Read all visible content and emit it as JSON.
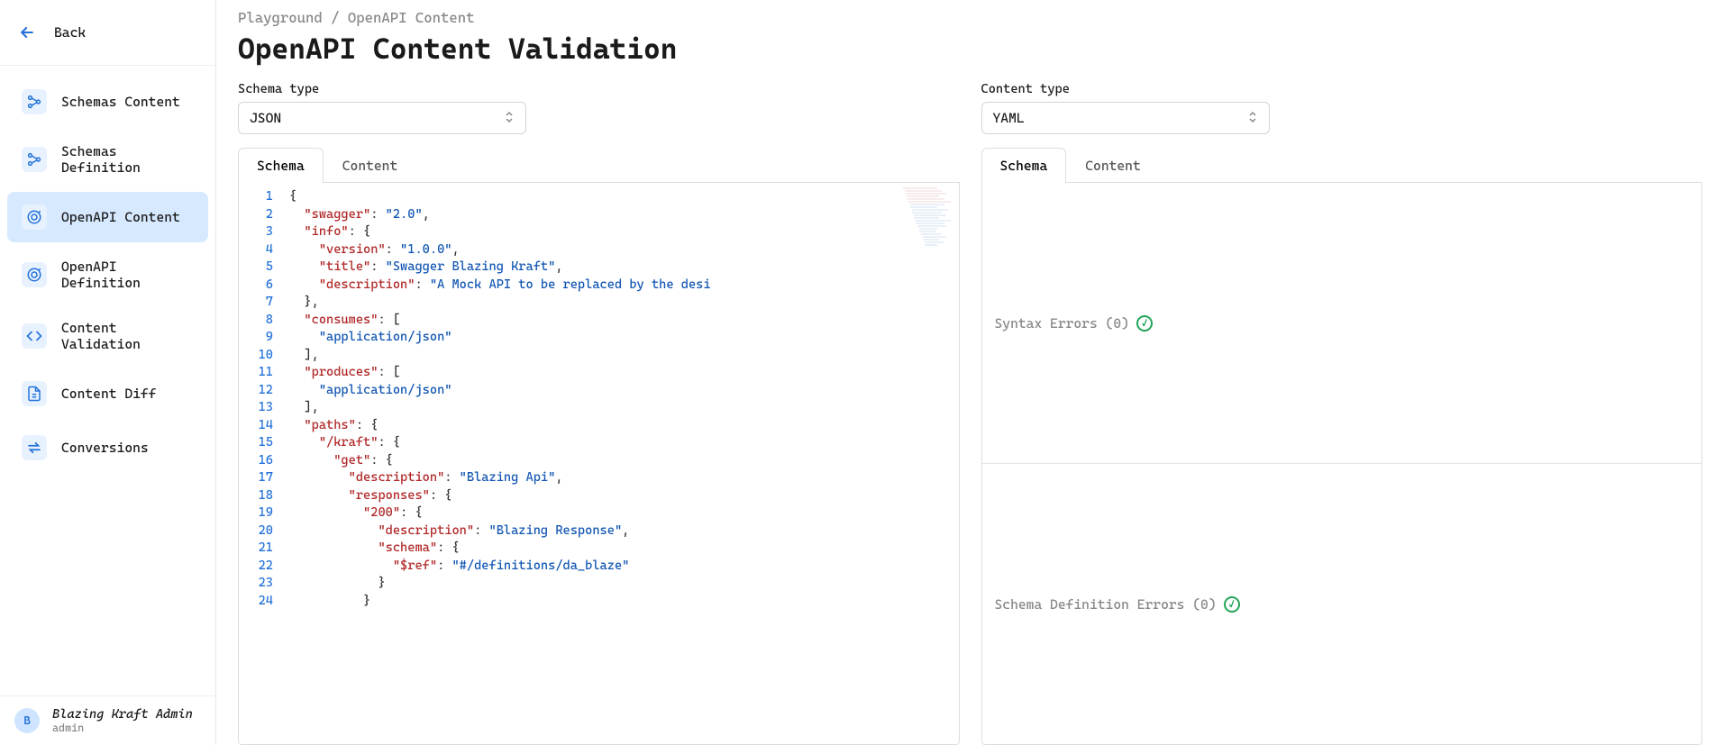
{
  "sidebar": {
    "back_label": "Back",
    "items": [
      {
        "label": "Schemas Content",
        "icon": "nodes-icon"
      },
      {
        "label": "Schemas Definition",
        "icon": "nodes-icon"
      },
      {
        "label": "OpenAPI Content",
        "icon": "target-icon",
        "active": true
      },
      {
        "label": "OpenAPI Definition",
        "icon": "target-icon"
      },
      {
        "label": "Content Validation",
        "icon": "code-icon"
      },
      {
        "label": "Content Diff",
        "icon": "file-icon"
      },
      {
        "label": "Conversions",
        "icon": "swap-icon"
      }
    ],
    "user": {
      "initial": "B",
      "name": "Blazing Kraft Admin",
      "role": "admin"
    }
  },
  "breadcrumb": "Playground / OpenAPI Content",
  "page_title": "OpenAPI Content Validation",
  "left": {
    "type_label": "Schema type",
    "type_value": "JSON",
    "tabs": [
      "Schema",
      "Content"
    ],
    "active_tab": 0,
    "code_lines": [
      [
        {
          "t": "{",
          "c": "p-punc"
        }
      ],
      [
        {
          "t": "  "
        },
        {
          "t": "\"swagger\"",
          "c": "p-key"
        },
        {
          "t": ": ",
          "c": "p-punc"
        },
        {
          "t": "\"2.0\"",
          "c": "p-str"
        },
        {
          "t": ",",
          "c": "p-punc"
        }
      ],
      [
        {
          "t": "  "
        },
        {
          "t": "\"info\"",
          "c": "p-key"
        },
        {
          "t": ": {",
          "c": "p-punc"
        }
      ],
      [
        {
          "t": "    "
        },
        {
          "t": "\"version\"",
          "c": "p-key"
        },
        {
          "t": ": ",
          "c": "p-punc"
        },
        {
          "t": "\"1.0.0\"",
          "c": "p-str"
        },
        {
          "t": ",",
          "c": "p-punc"
        }
      ],
      [
        {
          "t": "    "
        },
        {
          "t": "\"title\"",
          "c": "p-key"
        },
        {
          "t": ": ",
          "c": "p-punc"
        },
        {
          "t": "\"Swagger Blazing Kraft\"",
          "c": "p-str"
        },
        {
          "t": ",",
          "c": "p-punc"
        }
      ],
      [
        {
          "t": "    "
        },
        {
          "t": "\"description\"",
          "c": "p-key"
        },
        {
          "t": ": ",
          "c": "p-punc"
        },
        {
          "t": "\"A Mock API to be replaced by the desi",
          "c": "p-str"
        }
      ],
      [
        {
          "t": "  "
        },
        {
          "t": "},",
          "c": "p-punc"
        }
      ],
      [
        {
          "t": "  "
        },
        {
          "t": "\"consumes\"",
          "c": "p-key"
        },
        {
          "t": ": [",
          "c": "p-punc"
        }
      ],
      [
        {
          "t": "    "
        },
        {
          "t": "\"application/json\"",
          "c": "p-str"
        }
      ],
      [
        {
          "t": "  "
        },
        {
          "t": "],",
          "c": "p-punc"
        }
      ],
      [
        {
          "t": "  "
        },
        {
          "t": "\"produces\"",
          "c": "p-key"
        },
        {
          "t": ": [",
          "c": "p-punc"
        }
      ],
      [
        {
          "t": "    "
        },
        {
          "t": "\"application/json\"",
          "c": "p-str"
        }
      ],
      [
        {
          "t": "  "
        },
        {
          "t": "],",
          "c": "p-punc"
        }
      ],
      [
        {
          "t": "  "
        },
        {
          "t": "\"paths\"",
          "c": "p-key"
        },
        {
          "t": ": {",
          "c": "p-punc"
        }
      ],
      [
        {
          "t": "    "
        },
        {
          "t": "\"/kraft\"",
          "c": "p-key"
        },
        {
          "t": ": {",
          "c": "p-punc"
        }
      ],
      [
        {
          "t": "      "
        },
        {
          "t": "\"get\"",
          "c": "p-key"
        },
        {
          "t": ": {",
          "c": "p-punc"
        }
      ],
      [
        {
          "t": "        "
        },
        {
          "t": "\"description\"",
          "c": "p-key"
        },
        {
          "t": ": ",
          "c": "p-punc"
        },
        {
          "t": "\"Blazing Api\"",
          "c": "p-str"
        },
        {
          "t": ",",
          "c": "p-punc"
        }
      ],
      [
        {
          "t": "        "
        },
        {
          "t": "\"responses\"",
          "c": "p-key"
        },
        {
          "t": ": {",
          "c": "p-punc"
        }
      ],
      [
        {
          "t": "          "
        },
        {
          "t": "\"200\"",
          "c": "p-key"
        },
        {
          "t": ": {",
          "c": "p-punc"
        }
      ],
      [
        {
          "t": "            "
        },
        {
          "t": "\"description\"",
          "c": "p-key"
        },
        {
          "t": ": ",
          "c": "p-punc"
        },
        {
          "t": "\"Blazing Response\"",
          "c": "p-str"
        },
        {
          "t": ",",
          "c": "p-punc"
        }
      ],
      [
        {
          "t": "            "
        },
        {
          "t": "\"schema\"",
          "c": "p-key"
        },
        {
          "t": ": {",
          "c": "p-punc"
        }
      ],
      [
        {
          "t": "              "
        },
        {
          "t": "\"$ref\"",
          "c": "p-key"
        },
        {
          "t": ": ",
          "c": "p-punc"
        },
        {
          "t": "\"#/definitions/da_blaze\"",
          "c": "p-str"
        }
      ],
      [
        {
          "t": "            "
        },
        {
          "t": "}",
          "c": "p-punc"
        }
      ],
      [
        {
          "t": "          "
        },
        {
          "t": "}",
          "c": "p-punc"
        }
      ]
    ]
  },
  "right": {
    "type_label": "Content type",
    "type_value": "YAML",
    "tabs": [
      "Schema",
      "Content"
    ],
    "active_tab": 0,
    "status": [
      {
        "label": "Syntax Errors",
        "count": 0
      },
      {
        "label": "Schema Definition Errors",
        "count": 0
      }
    ]
  }
}
